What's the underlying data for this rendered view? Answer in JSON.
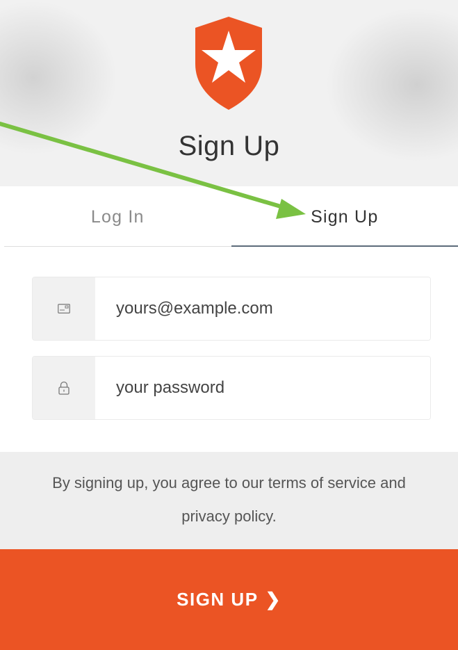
{
  "header": {
    "title": "Sign Up",
    "logo_icon": "auth0-shield-star-icon",
    "brand_color": "#eb5424"
  },
  "tabs": [
    {
      "label": "Log In",
      "active": false
    },
    {
      "label": "Sign Up",
      "active": true
    }
  ],
  "form": {
    "email": {
      "icon": "envelope-icon",
      "placeholder": "yours@example.com",
      "value": ""
    },
    "password": {
      "icon": "lock-icon",
      "placeholder": "your password",
      "value": ""
    }
  },
  "terms": {
    "line1": "By signing up, you agree to our terms of service and",
    "line2": "privacy policy."
  },
  "submit": {
    "label": "SIGN UP",
    "chevron": "❯"
  },
  "annotation": {
    "type": "arrow",
    "color": "#7ac143",
    "points_to": "Sign Up tab"
  }
}
